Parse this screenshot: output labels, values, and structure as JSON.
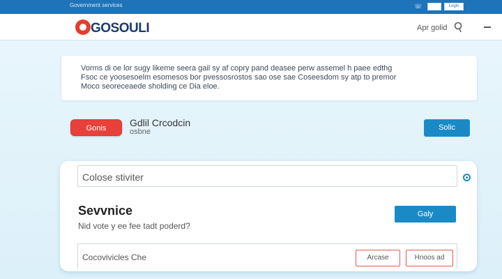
{
  "topbar": {
    "tagline": "Government services",
    "button_b": "Login"
  },
  "header": {
    "logo": "GOSOULI",
    "nav_link": "Apr golid"
  },
  "notice": {
    "lines": [
      "Vorms di oe lor sugy likeme seera gail sy af copry pand deasee perw assemel h paee edthg",
      "Fsoc ce yoosesoelm esomesos bor pvessosrostos sao ose sae Coseesdom sy atp to premor",
      "Moco seoreceaede sholding ce Dia eloe."
    ]
  },
  "actions": {
    "red_button": "Gonis",
    "caption_main": "Gdlil Crcodcin",
    "caption_sub": "osbne",
    "blue_button": "Solic"
  },
  "card": {
    "field_label": "Colose stiviter",
    "heading": "Sevvnice",
    "question": "Nid vote y ee fee tadt poderd?",
    "go_button": "Galy",
    "bottom_label": "Cocovivicles Che",
    "outline_button_1": "Arcase",
    "outline_button_2": "Hnoos ad"
  },
  "colors": {
    "topbar": "#1f73b8",
    "accent_red": "#e8403a",
    "accent_blue": "#1a8ac6",
    "background": "#e6f4fb"
  }
}
